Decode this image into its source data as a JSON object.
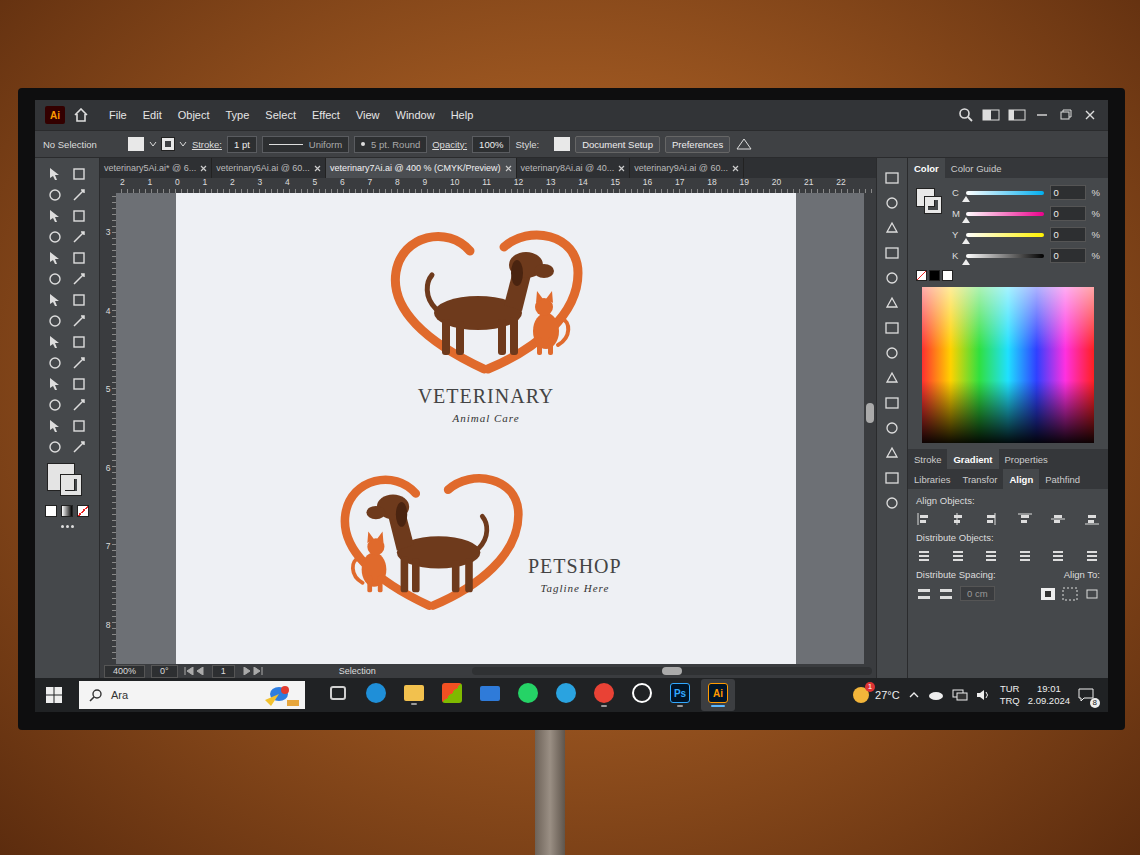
{
  "app": {
    "logo": "Ai",
    "menus": [
      "File",
      "Edit",
      "Object",
      "Type",
      "Select",
      "Effect",
      "View",
      "Window",
      "Help"
    ]
  },
  "control_bar": {
    "selection": "No Selection",
    "stroke_label": "Stroke:",
    "stroke_value": "1 pt",
    "profile": "Uniform",
    "brush": "5 pt. Round",
    "opacity_label": "Opacity:",
    "opacity": "100%",
    "style_label": "Style:",
    "buttons": [
      "Document Setup",
      "Preferences"
    ]
  },
  "tabs": [
    {
      "label": "veterinary5Ai.ai* @ 6...",
      "selected": false
    },
    {
      "label": "veterinary6Ai.ai @ 60...",
      "selected": false
    },
    {
      "label": "veterinary7Ai.ai @ 400 % (CMYK/Preview)",
      "selected": true
    },
    {
      "label": "veterinary8Ai.ai @ 40...",
      "selected": false
    },
    {
      "label": "veterinary9Ai.ai @ 60...",
      "selected": false
    }
  ],
  "rulers": {
    "horizontal": [
      "2",
      "1",
      "0",
      "1",
      "2",
      "3",
      "4",
      "5",
      "6",
      "7",
      "8",
      "9",
      "10",
      "11",
      "12",
      "13",
      "14",
      "15",
      "16",
      "17",
      "18",
      "19",
      "20",
      "21",
      "22"
    ],
    "vertical": [
      "3",
      "4",
      "5",
      "6",
      "7",
      "8"
    ]
  },
  "artboard": {
    "logos": [
      {
        "title": "VETERINARY",
        "tagline": "Animal Care",
        "kind": "stacked"
      },
      {
        "title": "PETSHOP",
        "tagline": "Tagline Here",
        "kind": "inline"
      }
    ]
  },
  "status_bar": {
    "zoom": "400%",
    "rotation": "0°",
    "artboard": "1",
    "tool": "Selection"
  },
  "color_panel": {
    "tabs": [
      {
        "label": "Color",
        "selected": true
      },
      {
        "label": "Color Guide",
        "selected": false
      }
    ],
    "channels": [
      {
        "name": "C",
        "level": 0,
        "value": "0",
        "unit": "%",
        "color": "#00aeef"
      },
      {
        "name": "M",
        "level": 0,
        "value": "0",
        "unit": "%",
        "color": "#ec008c"
      },
      {
        "name": "Y",
        "level": 0,
        "value": "0",
        "unit": "%",
        "color": "#fff200"
      },
      {
        "name": "K",
        "level": 0,
        "value": "0",
        "unit": "%",
        "color": "#000000"
      }
    ]
  },
  "panel_tabs": [
    {
      "label": "Stroke",
      "selected": false
    },
    {
      "label": "Gradient",
      "selected": true
    },
    {
      "label": "Properties",
      "selected": false
    }
  ],
  "panel_tabs_2": [
    {
      "label": "Libraries",
      "selected": false
    },
    {
      "label": "Transfor",
      "selected": false
    },
    {
      "label": "Align",
      "selected": true
    },
    {
      "label": "Pathfind",
      "selected": false
    }
  ],
  "align_panel": {
    "align_objects": "Align Objects:",
    "distribute_objects": "Distribute Objects:",
    "distribute_spacing": "Distribute Spacing:",
    "align_to": "Align To:",
    "spacing_value": "0 cm"
  },
  "taskbar": {
    "search_placeholder": "Ara",
    "apps": [
      {
        "kind": "task-view",
        "selected": false,
        "running": false,
        "color": "#d0d0d0"
      },
      {
        "kind": "circle",
        "selected": false,
        "running": false,
        "color": "#1f8fd8"
      },
      {
        "kind": "folder",
        "selected": false,
        "running": true,
        "color": "#f2c14e"
      },
      {
        "kind": "tile",
        "selected": false,
        "running": false,
        "color": "#f3f3f3"
      },
      {
        "kind": "mail",
        "selected": false,
        "running": false,
        "color": "#2f7bd9"
      },
      {
        "kind": "circle",
        "selected": false,
        "running": false,
        "color": "#25d366"
      },
      {
        "kind": "circle",
        "selected": false,
        "running": false,
        "color": "#2aa3e0"
      },
      {
        "kind": "circle",
        "selected": false,
        "running": true,
        "color": "#e94235"
      },
      {
        "kind": "ring",
        "selected": false,
        "running": false,
        "color": "#ffffff"
      },
      {
        "kind": "badge",
        "label": "Ps",
        "selected": false,
        "running": true,
        "color": "#31a8ff"
      },
      {
        "kind": "badge",
        "label": "Ai",
        "selected": true,
        "running": true,
        "color": "#ff9a00"
      }
    ],
    "weather": "27°C",
    "weather_badge": "1",
    "language": [
      "TUR",
      "TRQ"
    ],
    "time": "19:01",
    "date": "2.09.2024",
    "notifications": "8"
  }
}
